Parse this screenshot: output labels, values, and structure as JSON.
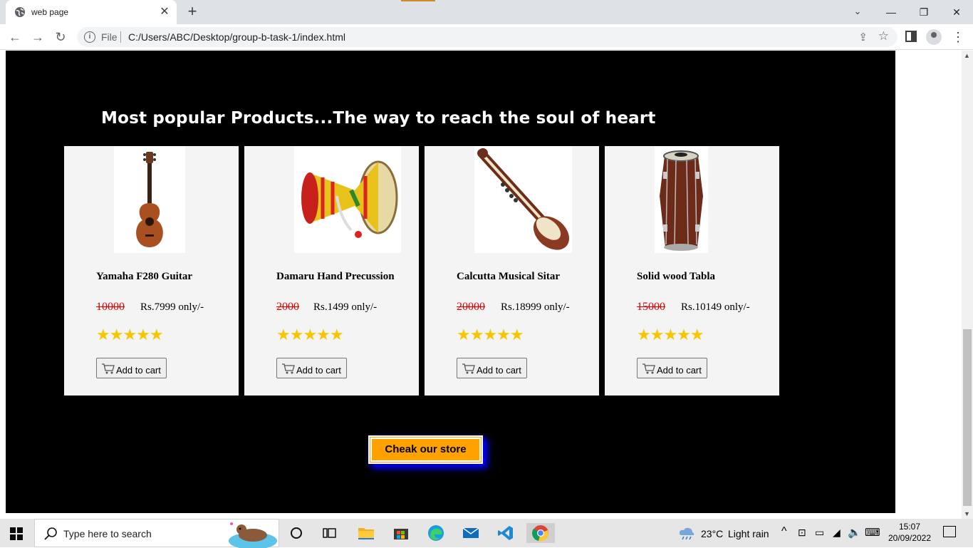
{
  "browser": {
    "tab_title": "web page",
    "omnibox_scheme": "File",
    "omnibox_url": "C:/Users/ABC/Desktop/group-b-task-1/index.html"
  },
  "page": {
    "section_title": "Most popular Products...The way to reach the soul of heart",
    "products": [
      {
        "name": "Yamaha F280 Guitar",
        "old_price": "10000",
        "new_price": "Rs.7999 only/-",
        "rating": 5,
        "stars": "★★★★★",
        "button": "Add to cart",
        "image": "ukulele"
      },
      {
        "name": "Damaru Hand Precussion",
        "old_price": "2000",
        "new_price": "Rs.1499 only/-",
        "rating": 5,
        "stars": "★★★★★",
        "button": "Add to cart",
        "image": "damaru-drum"
      },
      {
        "name": "Calcutta Musical Sitar",
        "old_price": "20000",
        "new_price": "Rs.18999 only/-",
        "rating": 5,
        "stars": "★★★★★",
        "button": "Add to cart",
        "image": "sitar"
      },
      {
        "name": "Solid wood Tabla",
        "old_price": "15000",
        "new_price": "Rs.10149 only/-",
        "rating": 5,
        "stars": "★★★★★",
        "button": "Add to cart",
        "image": "tabla-drum"
      }
    ],
    "store_button": "Cheak our store",
    "colors": {
      "background": "#000000",
      "card": "#f4f4f4",
      "strike_price": "#e00000",
      "star": "#f7c600",
      "store_button": "#ffa200",
      "store_glow": "#0000ff"
    }
  },
  "taskbar": {
    "search_placeholder": "Type here to search",
    "weather_temp": "23°C",
    "weather_text": "Light rain",
    "time": "15:07",
    "date": "20/09/2022"
  }
}
